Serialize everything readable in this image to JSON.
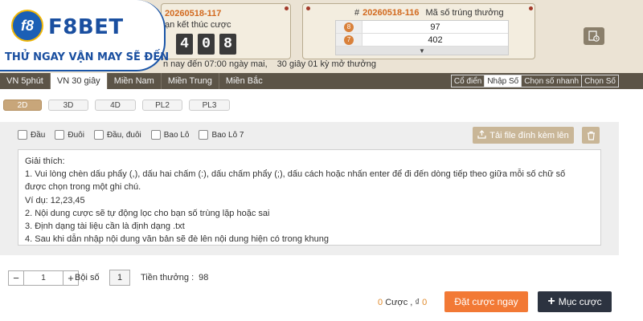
{
  "header": {
    "current_round": "20260518-117",
    "countdown_label": "ạn kết thúc cược",
    "digits": [
      "4",
      "0",
      "8"
    ],
    "previous_round_hash": "#",
    "previous_round": "20260518-116",
    "previous_label": "Mã số trúng thưởng",
    "results": [
      {
        "index": "8",
        "value": "97"
      },
      {
        "index": "7",
        "value": "402"
      }
    ],
    "expand_icon": "chevron-down-icon",
    "history_icon": "history-icon",
    "countdown_text": "n nay đến 07:00 ngày mai,",
    "countdown_next": "30 giây 01 kỳ mở thưởng"
  },
  "logo": {
    "mark": "f8",
    "name": "F8BET",
    "slogan": "THỬ NGAY VẬN MAY SẼ ĐẾN"
  },
  "nav": {
    "tabs": [
      "VN 5phút",
      "VN 30 giây",
      "Miền Nam",
      "Miền Trung",
      "Miền Bắc"
    ],
    "active_tab": "VN 5phút",
    "modes": [
      "Cổ điển",
      "Nhập Số",
      "Chọn số nhanh",
      "Chọn Số"
    ],
    "active_mode": "Nhập Số"
  },
  "subtabs": [
    "2D",
    "3D",
    "4D",
    "PL2",
    "PL3"
  ],
  "active_subtab": "2D",
  "panel": {
    "options": [
      "Đầu",
      "Đuôi",
      "Đầu, đuôi",
      "Bao Lô",
      "Bao Lô 7"
    ],
    "upload_label": "Tải file đính kèm lên",
    "instructions": [
      "Giải thích:",
      "1. Vui lòng chèn dấu phẩy (,), dấu hai chấm (:), dấu chấm phẩy (;), dấu cách hoặc nhấn enter để đi đến dòng tiếp theo giữa mỗi số chữ số",
      "được chọn trong một ghi chú.",
      "Ví dụ: 12,23,45",
      "2. Nội dung cược sẽ tự động lọc cho bạn số trùng lặp hoặc sai",
      "3. Định dạng tài liệu cần là định dạng .txt",
      "4. Sau khi dẫn nhập nội dung văn bản sẽ đè lên nội dung hiện có trong khung"
    ]
  },
  "bottom": {
    "qty_minus": "−",
    "qty_value": "1",
    "qty_plus": "+",
    "multiplier_label": "Bội số",
    "multiplier_value": "1",
    "prize_label": "Tiền thưởng :",
    "prize_value": "98",
    "bet_count": "0",
    "bet_count_label": "Cược ,",
    "currency_symbol": "₫",
    "bet_amount": "0",
    "place_bet_label": "Đặt cược ngay",
    "list_label": "Mục cược"
  },
  "colors": {
    "accent_orange": "#f27935",
    "nav_bg": "#5c5447",
    "brand_blue": "#1a4fa0"
  }
}
